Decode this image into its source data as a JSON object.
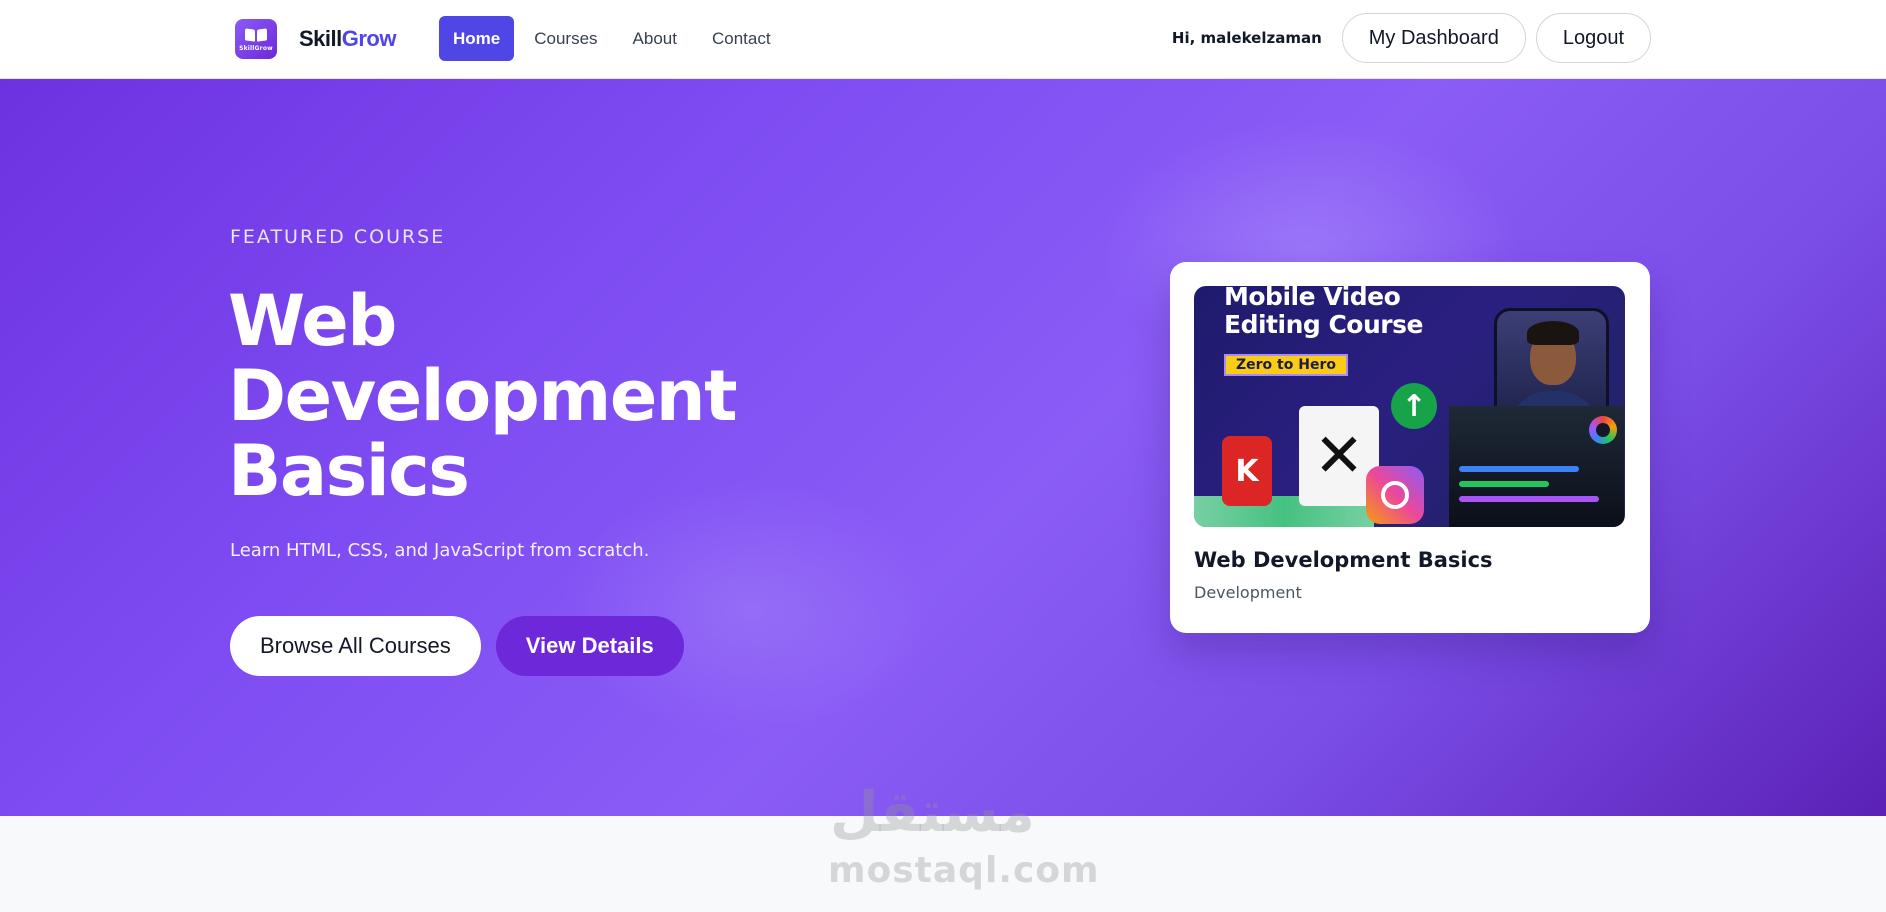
{
  "brand": {
    "logo_text": "SkillGrow",
    "name_part1": "Skill",
    "name_part2": "Grow"
  },
  "nav": {
    "links": [
      {
        "label": "Home",
        "active": true
      },
      {
        "label": "Courses",
        "active": false
      },
      {
        "label": "About",
        "active": false
      },
      {
        "label": "Contact",
        "active": false
      }
    ]
  },
  "user": {
    "greeting": "Hi, malekelzaman",
    "dashboard_label": "My Dashboard",
    "logout_label": "Logout"
  },
  "hero": {
    "eyebrow": "FEATURED COURSE",
    "title": "Web Development Basics",
    "subtitle": "Learn HTML, CSS, and JavaScript from scratch.",
    "primary_cta": "Browse All Courses",
    "secondary_cta": "View Details"
  },
  "card": {
    "thumbnail": {
      "line1": "Mobile Video",
      "line2": "Editing Course",
      "tag": "Zero to Hero",
      "capcut_glyph": "✕",
      "kine_glyph": "K",
      "arrow_glyph": "↑"
    },
    "title": "Web Development Basics",
    "category": "Development"
  },
  "watermark": {
    "arabic": "مستقل",
    "latin": "mostaql.com"
  },
  "colors": {
    "accent": "#4f46e5",
    "hero_start": "#6d32e0",
    "hero_end": "#5b21b6",
    "button_purple": "#6d28d9"
  }
}
